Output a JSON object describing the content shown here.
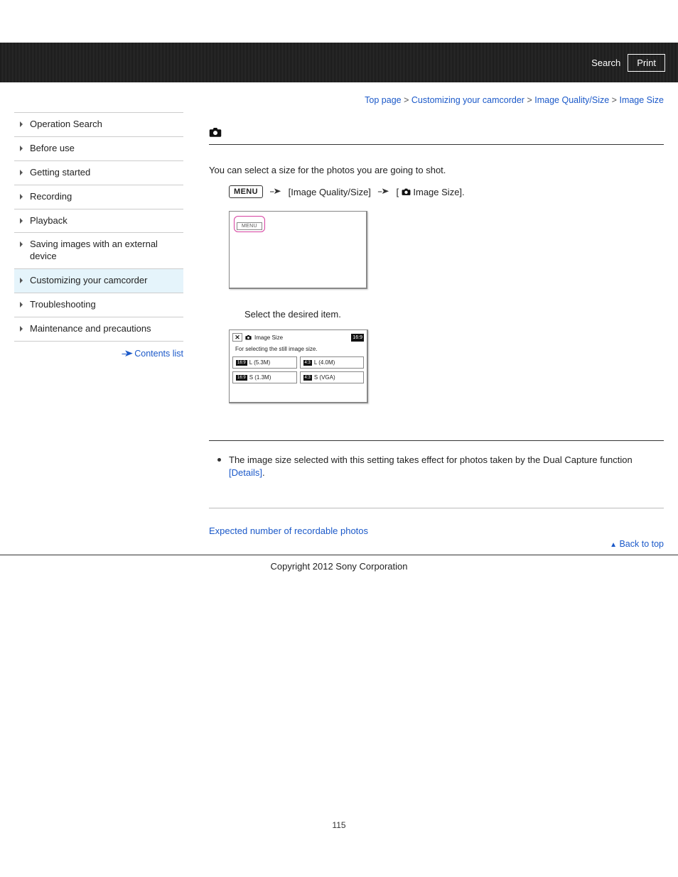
{
  "header": {
    "search": "Search",
    "print": "Print"
  },
  "breadcrumb": {
    "items": [
      "Top page",
      "Customizing your camcorder",
      "Image Quality/Size",
      "Image Size"
    ],
    "sep": ">"
  },
  "sidebar": {
    "items": [
      {
        "label": "Operation Search"
      },
      {
        "label": "Before use"
      },
      {
        "label": "Getting started"
      },
      {
        "label": "Recording"
      },
      {
        "label": "Playback"
      },
      {
        "label": "Saving images with an external device"
      },
      {
        "label": "Customizing your camcorder",
        "active": true
      },
      {
        "label": "Troubleshooting"
      },
      {
        "label": "Maintenance and precautions"
      }
    ],
    "contents_list": "Contents list"
  },
  "main": {
    "intro": "You can select a size for the photos you are going to shot.",
    "menu_chip": "MENU",
    "path1": "[Image Quality/Size]",
    "path2_prefix": "[",
    "path2_label": "Image Size].",
    "screen_menu_chip": "MENU",
    "step2": "Select the desired item.",
    "sizebox": {
      "close": "✕",
      "title": "Image Size",
      "aspect_badge": "16:9",
      "desc": "For selecting the still image size.",
      "opts": [
        {
          "asp": "16:9",
          "txt": "L (5.3M)"
        },
        {
          "asp": "4:3",
          "txt": "L (4.0M)"
        },
        {
          "asp": "16:9",
          "txt": "S (1.3M)"
        },
        {
          "asp": "4:3",
          "txt": "S (VGA)"
        }
      ]
    },
    "note": "The image size selected with this setting takes effect for photos taken by the Dual Capture function ",
    "details": "[Details]",
    "period": ".",
    "related": "Expected number of recordable photos",
    "back_to_top": "Back to top"
  },
  "footer": {
    "copyright": "Copyright 2012 Sony Corporation"
  },
  "page_number": "115"
}
